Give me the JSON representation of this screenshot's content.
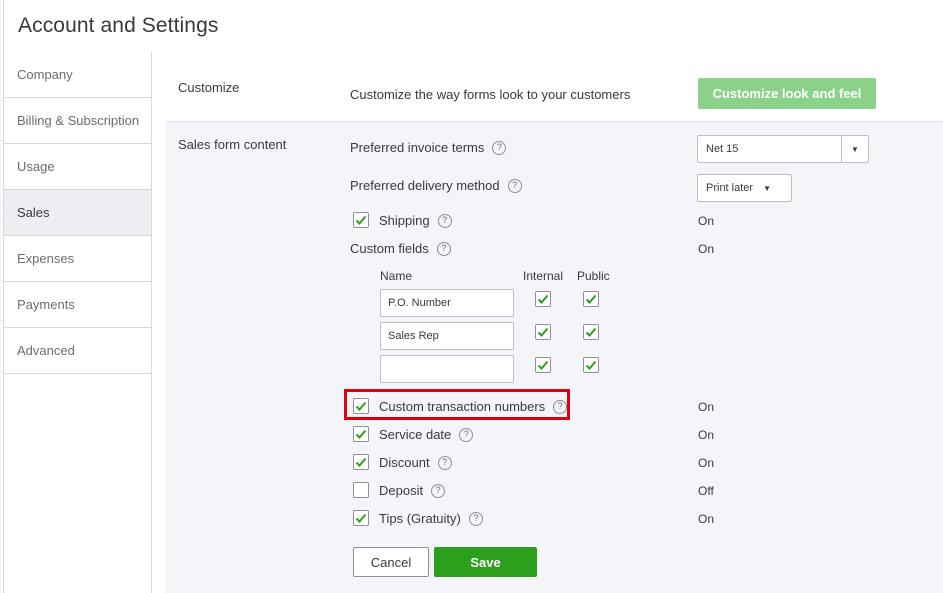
{
  "dialog": {
    "title": "Account and Settings"
  },
  "sidebar": {
    "items": [
      {
        "label": "Company"
      },
      {
        "label": "Billing & Subscription"
      },
      {
        "label": "Usage"
      },
      {
        "label": "Sales",
        "active": true
      },
      {
        "label": "Expenses"
      },
      {
        "label": "Payments"
      },
      {
        "label": "Advanced"
      }
    ]
  },
  "customize": {
    "section_label": "Customize",
    "description": "Customize the way forms look to your customers",
    "button_label": "Customize look and feel"
  },
  "sales_form": {
    "section_label": "Sales form content",
    "invoice_terms": {
      "label": "Preferred invoice terms",
      "value": "Net 15"
    },
    "delivery_method": {
      "label": "Preferred delivery method",
      "value": "Print later"
    },
    "shipping": {
      "label": "Shipping",
      "checked": true,
      "status": "On"
    },
    "custom_fields": {
      "label": "Custom fields",
      "status": "On",
      "headers": {
        "name": "Name",
        "internal": "Internal",
        "public": "Public"
      },
      "rows": [
        {
          "value": "P.O. Number",
          "internal": true,
          "public": true
        },
        {
          "value": "Sales Rep",
          "internal": true,
          "public": true
        },
        {
          "value": "",
          "internal": true,
          "public": true
        }
      ]
    },
    "custom_transaction_numbers": {
      "label": "Custom transaction numbers",
      "checked": true,
      "status": "On"
    },
    "service_date": {
      "label": "Service date",
      "checked": true,
      "status": "On"
    },
    "discount": {
      "label": "Discount",
      "checked": true,
      "status": "On"
    },
    "deposit": {
      "label": "Deposit",
      "checked": false,
      "status": "Off"
    },
    "tips": {
      "label": "Tips (Gratuity)",
      "checked": true,
      "status": "On"
    }
  },
  "actions": {
    "cancel_label": "Cancel",
    "save_label": "Save"
  },
  "icons": {
    "help": "?"
  },
  "colors": {
    "accent": "#2ca01c",
    "accent_light": "#8bd18a",
    "highlight": "#e1000f"
  }
}
